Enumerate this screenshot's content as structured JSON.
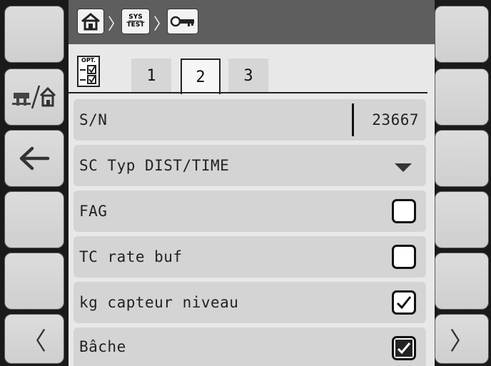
{
  "breadcrumb": {
    "sys_test_line1": "SYS",
    "sys_test_line2": "TEST"
  },
  "option_badge": "OPT.",
  "tabs": [
    {
      "label": "1"
    },
    {
      "label": "2"
    },
    {
      "label": "3"
    }
  ],
  "active_tab": "2",
  "rows": [
    {
      "label": "S/N",
      "value": "23667"
    },
    {
      "label": "SC Typ DIST/TIME"
    },
    {
      "label": "FAG",
      "checked": false
    },
    {
      "label": "TC rate buf",
      "checked": false
    },
    {
      "label": "kg capteur niveau",
      "checked": true
    },
    {
      "label": "Bâche",
      "checked": true
    }
  ],
  "left_buttons": [
    "",
    "machine-home-toggle-icon",
    "back-arrow-icon",
    "",
    "",
    "prev-page-icon"
  ],
  "right_buttons": [
    "",
    "",
    "",
    "",
    "",
    "next-page-icon"
  ],
  "nav": {
    "prev_glyph": "〈",
    "next_glyph": "〉"
  }
}
